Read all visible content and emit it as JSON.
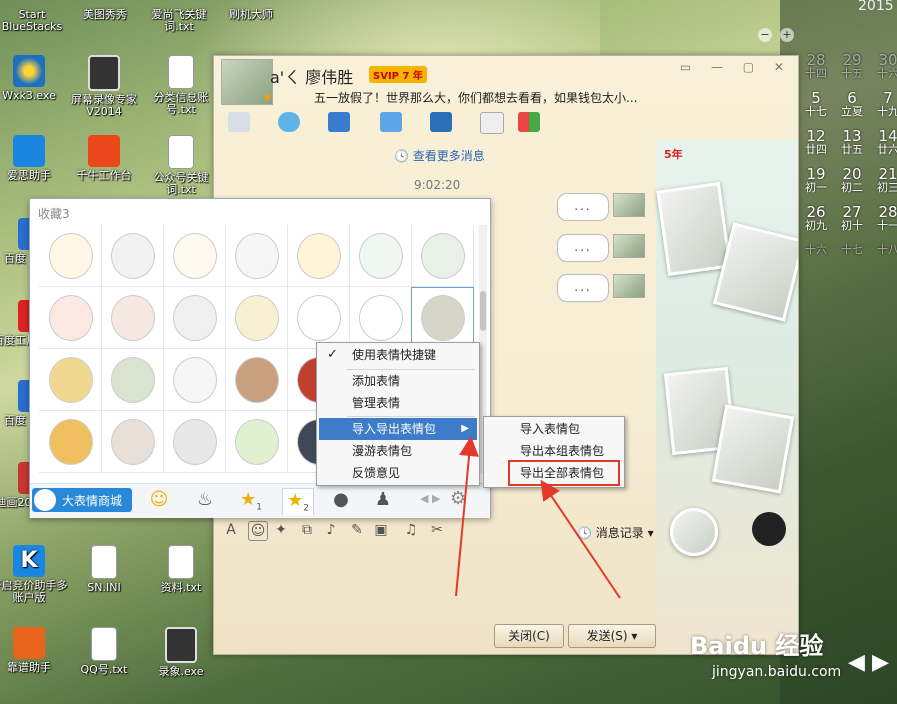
{
  "desktop": {
    "top_labels": [
      "Start BlueStacks",
      "美图秀秀",
      "爱尚飞关键词.txt",
      "刷机大师"
    ],
    "icons": [
      {
        "label": "Wxk3.exe"
      },
      {
        "label": "屏幕录像专家V2014"
      },
      {
        "label": "分类信息账号.txt"
      },
      {
        "label": "爱思助手"
      },
      {
        "label": "千牛工作台"
      },
      {
        "label": "公众号关键词.txt"
      },
      {
        "label": "百度"
      },
      {
        "label": "百度工片"
      },
      {
        "label": "百度"
      },
      {
        "label": "秦迪画2014"
      },
      {
        "label": "开启竞价助手多账户版"
      },
      {
        "label": "SN.INI"
      },
      {
        "label": "资料.txt"
      },
      {
        "label": "靠谱助手"
      },
      {
        "label": "QQ号.txt"
      },
      {
        "label": "录象.exe"
      }
    ]
  },
  "calendar": {
    "year": "2015",
    "rows": [
      [
        {
          "d": "28",
          "l": "十四"
        },
        {
          "d": "29",
          "l": "十五"
        },
        {
          "d": "30",
          "l": "十六"
        }
      ],
      [
        {
          "d": "5",
          "l": "十七"
        },
        {
          "d": "6",
          "l": "立夏"
        },
        {
          "d": "7",
          "l": "十九"
        }
      ],
      [
        {
          "d": "12",
          "l": "廿四"
        },
        {
          "d": "13",
          "l": "廿五"
        },
        {
          "d": "14",
          "l": "廿六"
        }
      ],
      [
        {
          "d": "19",
          "l": "初一"
        },
        {
          "d": "20",
          "l": "初二"
        },
        {
          "d": "21",
          "l": "初三"
        }
      ],
      [
        {
          "d": "26",
          "l": "初九"
        },
        {
          "d": "27",
          "l": "初十"
        },
        {
          "d": "28",
          "l": "十一"
        }
      ],
      [
        {
          "d": "",
          "l": "十六"
        },
        {
          "d": "",
          "l": "十七"
        },
        {
          "d": "",
          "l": "十八"
        }
      ]
    ]
  },
  "chat": {
    "contact_name": "a'ㄑ 廖伟胜",
    "vip_badge": "SVIP 7",
    "vip_year": "年",
    "signature": "五一放假了！世界那么大，你们都想去看看，如果钱包太小...",
    "more_messages": "查看更多消息",
    "time": "9:02:20",
    "bubbles": [
      "...",
      "...",
      "..."
    ],
    "side_badge": "5年",
    "message_record": "消息记录",
    "close_button": "关闭(C)",
    "send_button": "发送(S)"
  },
  "emoticon_panel": {
    "title": "收藏3",
    "mall_button": "大表情商城",
    "tabs": [
      {
        "icon": "smile-icon",
        "glyph": "☺",
        "sub": ""
      },
      {
        "icon": "emoji-figure-icon",
        "glyph": "♨",
        "sub": ""
      },
      {
        "icon": "star-icon",
        "glyph": "★",
        "sub": "1"
      },
      {
        "icon": "star-icon",
        "glyph": "★",
        "sub": "2"
      },
      {
        "icon": "panda-icon",
        "glyph": "●",
        "sub": ""
      },
      {
        "icon": "figure-icon",
        "glyph": "♟",
        "sub": ""
      }
    ]
  },
  "context_menu": {
    "items": [
      {
        "label": "使用表情快捷键",
        "checked": true
      },
      {
        "label": "添加表情"
      },
      {
        "label": "管理表情"
      },
      {
        "label": "导入导出表情包",
        "highlight": true,
        "submenu": true
      },
      {
        "label": "漫游表情包"
      },
      {
        "label": "反馈意见"
      }
    ]
  },
  "submenu": {
    "items": [
      {
        "label": "导入表情包"
      },
      {
        "label": "导出本组表情包"
      },
      {
        "label": "导出全部表情包",
        "boxed": true
      }
    ]
  },
  "watermark": {
    "brand": "Baidu 经验",
    "url": "jingyan.baidu.com"
  },
  "colors": {
    "accent": "#3c7cc8",
    "annotation": "#e23a2a",
    "mall_blue": "#2a88d8"
  }
}
